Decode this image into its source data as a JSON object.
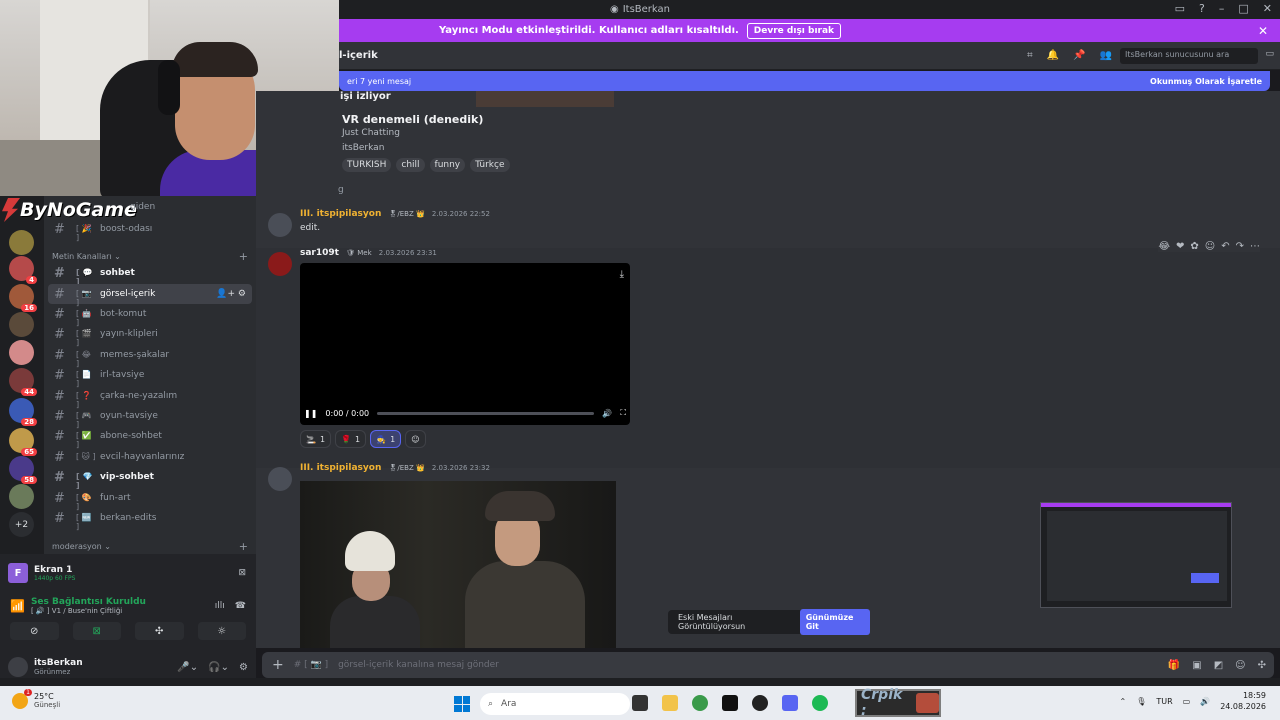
{
  "window": {
    "title": "ItsBerkan"
  },
  "streamer_banner": {
    "message": "Yayıncı Modu etkinleştirildi. Kullanıcı adları kısaltıldı.",
    "disable_label": "Devre dışı bırak",
    "close": "✕"
  },
  "overlay": {
    "logo_text": "ByNoGame",
    "partial_label": "giden"
  },
  "guilds": {
    "items": [
      {
        "color": "#8a7a3a",
        "badge": ""
      },
      {
        "color": "#b54a4a",
        "badge": "4"
      },
      {
        "color": "#a0593a",
        "badge": "16"
      },
      {
        "color": "#5a4a3a",
        "badge": ""
      },
      {
        "color": "#d38a8a",
        "badge": ""
      },
      {
        "color": "#7a3a3a",
        "badge": "44"
      },
      {
        "color": "#3a5ab5",
        "badge": "28"
      },
      {
        "color": "#c09a4a",
        "badge": "65"
      },
      {
        "color": "#4a3a8a",
        "badge": "58"
      },
      {
        "color": "#6a7a5a",
        "badge": ""
      }
    ],
    "more": "+2"
  },
  "channels": {
    "top_item": {
      "emoji": "[ 🎉 ]",
      "name": "boost-odası"
    },
    "category_text": "Metin Kanalları",
    "items": [
      {
        "emoji": "[ 💬 ]",
        "name": "sohbet"
      },
      {
        "emoji": "[ 📷 ]",
        "name": "görsel-içerik"
      },
      {
        "emoji": "[ 🤖 ]",
        "name": "bot-komut"
      },
      {
        "emoji": "[ 🎬 ]",
        "name": "yayın-klipleri"
      },
      {
        "emoji": "[ 😂 ]",
        "name": "memes-şakalar"
      },
      {
        "emoji": "[ 📄 ]",
        "name": "irl-tavsiye"
      },
      {
        "emoji": "[ ❓ ]",
        "name": "çarka-ne-yazalım"
      },
      {
        "emoji": "[ 🎮 ]",
        "name": "oyun-tavsiye"
      },
      {
        "emoji": "[ ✅ ]",
        "name": "abone-sohbet"
      },
      {
        "emoji": "[ 🐱 ]",
        "name": "evcil-hayvanlarınız"
      },
      {
        "emoji": "[ 💎 ]",
        "name": "vip-sohbet"
      },
      {
        "emoji": "[ 🎨 ]",
        "name": "fun-art"
      },
      {
        "emoji": "[ 🆕 ]",
        "name": "berkan-edits"
      }
    ],
    "category_mod": "moderasyon"
  },
  "voice": {
    "screen_title": "Ekran 1",
    "screen_sub": "1440p 60 FPS",
    "connected": "Ses Bağlantısı Kuruldu",
    "channel": "[ 🔊 ] V1 / Buse'nin Çiftliği"
  },
  "user": {
    "name": "itsBerkan",
    "status": "Görünmez"
  },
  "header": {
    "channel_name": "l-içerik",
    "search_placeholder": "ItsBerkan sunucusunu ara"
  },
  "new_messages": {
    "text": "eri 7 yeni mesaj",
    "mark_read": "Okunmuş Olarak İşaretle"
  },
  "stream_embed": {
    "watching": "işi izliyor",
    "title": "VR denemeli (denedik)",
    "game": "Just Chatting",
    "user": "itsBerkan",
    "tags": [
      "TURKISH",
      "chill",
      "funny",
      "Türkçe"
    ],
    "stray": "g"
  },
  "messages": [
    {
      "author": "III. itspipilasyon",
      "role": "🎖/EBZ 👑",
      "time": "2.03.2026 22:52",
      "text": "edit.",
      "color": "#f0b232"
    },
    {
      "author": "sar109t",
      "role": "🛡 Mek",
      "time": "2.03.2026 23:31",
      "text": "",
      "color": "#f2f3f5"
    },
    {
      "author": "III. itspipilasyon",
      "role": "🎖/EBZ 👑",
      "time": "2.03.2026 23:32",
      "text": "",
      "color": "#f0b232"
    }
  ],
  "video": {
    "time": "0:00 / 0:00"
  },
  "reactions": [
    {
      "emoji": "🚬",
      "count": "1"
    },
    {
      "emoji": "🌹",
      "count": "1"
    },
    {
      "emoji": "🧙",
      "count": "1"
    }
  ],
  "old_messages": {
    "text": "Eski Mesajları Görüntülüyorsun",
    "button": "Günümüze Git"
  },
  "composer": {
    "placeholder": "görsel-içerik kanalına mesaj gönder",
    "prefix": "# [ 📷 ]"
  },
  "taskbar": {
    "temp": "25°C",
    "weather": "Güneşli",
    "search": "Ara",
    "crpik": "Crpik :",
    "lang": "TUR",
    "time": "18:59",
    "date": "24.08.2026"
  },
  "colors": {
    "accent": "#5865f2",
    "streamer": "#a63cf0",
    "online": "#23a55a"
  }
}
